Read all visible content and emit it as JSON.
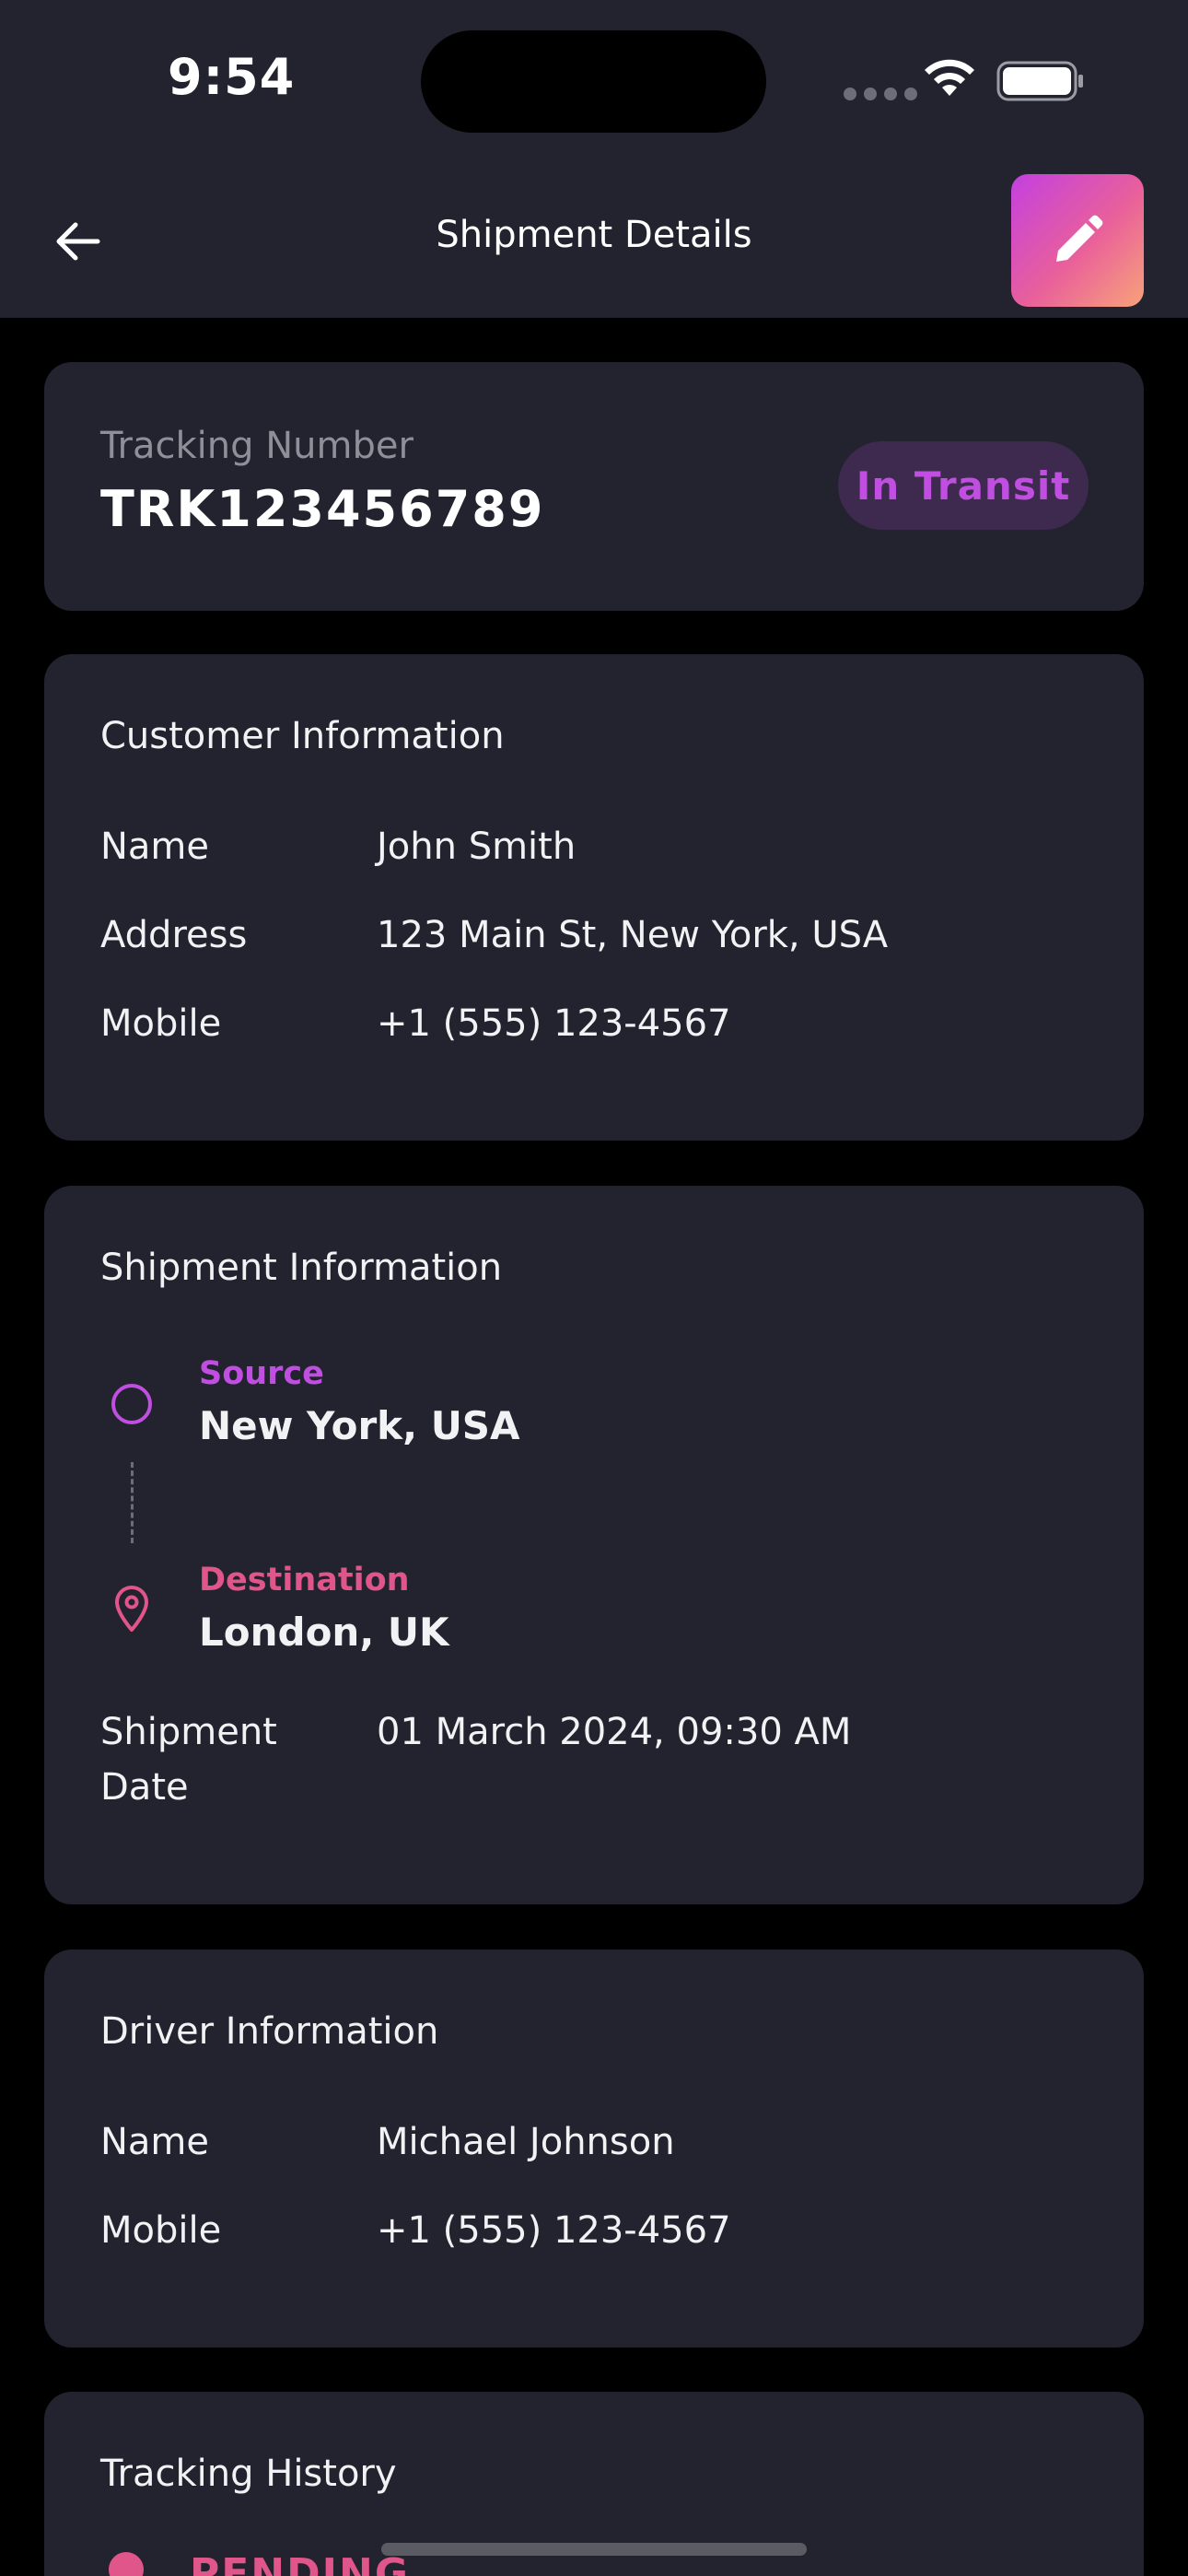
{
  "status_bar": {
    "time": "9:54"
  },
  "header": {
    "title": "Shipment Details"
  },
  "tracking": {
    "label": "Tracking Number",
    "number": "TRK123456789",
    "status": "In Transit"
  },
  "customer": {
    "title": "Customer Information",
    "rows": [
      {
        "label": "Name",
        "value": "John Smith"
      },
      {
        "label": "Address",
        "value": "123 Main St, New York, USA"
      },
      {
        "label": "Mobile",
        "value": "+1 (555) 123-4567"
      }
    ]
  },
  "shipment": {
    "title": "Shipment Information",
    "source_label": "Source",
    "source_value": "New York, USA",
    "destination_label": "Destination",
    "destination_value": "London, UK",
    "date_label_line1": "Shipment",
    "date_label_line2": "Date",
    "date_value": "01 March 2024, 09:30 AM"
  },
  "driver": {
    "title": "Driver Information",
    "rows": [
      {
        "label": "Name",
        "value": "Michael Johnson"
      },
      {
        "label": "Mobile",
        "value": "+1 (555) 123-4567"
      }
    ]
  },
  "history": {
    "title": "Tracking History",
    "first_status": "PENDING"
  },
  "colors": {
    "accent_purple": "#c04ee0",
    "accent_pink": "#e0558a",
    "card_bg": "#22232e",
    "page_bg": "#000000"
  }
}
